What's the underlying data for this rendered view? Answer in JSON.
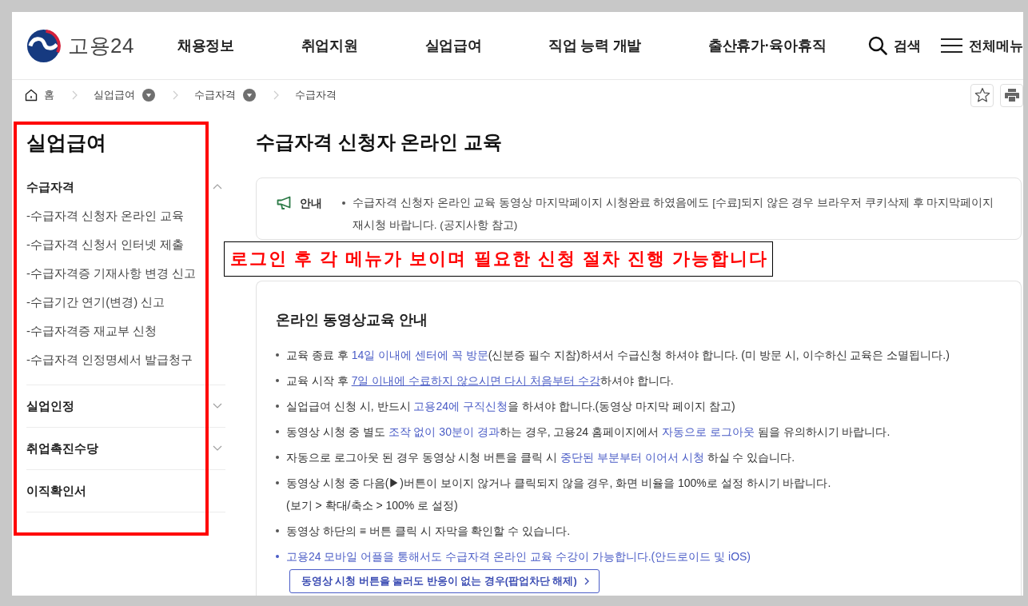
{
  "header": {
    "logo_text": "고용24",
    "nav": [
      "채용정보",
      "취업지원",
      "실업급여",
      "직업 능력 개발",
      "출산휴가·육아휴직"
    ],
    "search_label": "검색",
    "menu_label": "전체메뉴"
  },
  "breadcrumb": [
    {
      "label": "홈",
      "kind": "home"
    },
    {
      "label": "실업급여",
      "kind": "dropdown"
    },
    {
      "label": "수급자격",
      "kind": "dropdown"
    },
    {
      "label": "수급자격",
      "kind": "current"
    }
  ],
  "sidebar": {
    "title": "실업급여",
    "sections": [
      {
        "label": "수급자격",
        "kind": "group",
        "expanded": true,
        "children": [
          {
            "label": "-수급자격 신청자 온라인 교육"
          },
          {
            "label": "-수급자격 신청서 인터넷 제출"
          },
          {
            "label": "-수급자격증 기재사항 변경 신고"
          },
          {
            "label": "-수급기간 연기(변경) 신고"
          },
          {
            "label": "-수급자격증 재교부 신청"
          },
          {
            "label": "-수급자격 인정명세서 발급청구"
          }
        ]
      },
      {
        "label": "실업인정",
        "kind": "group",
        "expanded": false
      },
      {
        "label": "취업촉진수당",
        "kind": "group",
        "expanded": false
      },
      {
        "label": "이직확인서",
        "kind": "link"
      }
    ]
  },
  "page_title": "수급자격 신청자 온라인 교육",
  "notice": {
    "label": "안내",
    "text": "수급자격 신청자 온라인 교육 동영상 마지막페이지 시청완료 하였음에도 [수료]되지 않은 경우 브라우저 쿠키삭제 후 마지막페이지 재시청 바랍니다. (공지사항 참고)"
  },
  "guide": {
    "title": "온라인 동영상교육 안내",
    "items": [
      {
        "segments": [
          {
            "text": "교육 종료 후 ",
            "kind": "plain"
          },
          {
            "text": "14일 이내에 센터에 꼭 방문",
            "kind": "highlight"
          },
          {
            "text": "(신분증 필수 지참)하셔서 수급신청 하셔야 합니다. (미 방문 시, 이수하신 교육은 소멸됩니다.)",
            "kind": "plain"
          }
        ]
      },
      {
        "segments": [
          {
            "text": "교육 시작 후 ",
            "kind": "plain"
          },
          {
            "text": "7일 이내에 수료하지 않으시면 다시 처음부터 수강",
            "kind": "link"
          },
          {
            "text": "하셔야 합니다.",
            "kind": "plain"
          }
        ]
      },
      {
        "segments": [
          {
            "text": "실업급여 신청 시, 반드시 ",
            "kind": "plain"
          },
          {
            "text": "고용24에 구직신청",
            "kind": "highlight"
          },
          {
            "text": "을 하셔야 합니다.(동영상 마지막 페이지 참고)",
            "kind": "plain"
          }
        ]
      },
      {
        "segments": [
          {
            "text": "동영상 시청 중 별도 ",
            "kind": "plain"
          },
          {
            "text": "조작 없이 30분이 경과",
            "kind": "highlight"
          },
          {
            "text": "하는 경우, 고용24 홈페이지에서 ",
            "kind": "plain"
          },
          {
            "text": "자동으로 로그아웃",
            "kind": "highlight"
          },
          {
            "text": " 됨을 유의하시기 바랍니다.",
            "kind": "plain"
          }
        ]
      },
      {
        "segments": [
          {
            "text": "자동으로 로그아웃 된 경우 동영상 시청 버튼을 클릭 시 ",
            "kind": "plain"
          },
          {
            "text": "중단된 부분부터 이어서 시청",
            "kind": "highlight"
          },
          {
            "text": " 하실 수 있습니다.",
            "kind": "plain"
          }
        ]
      },
      {
        "segments": [
          {
            "text": "동영상 시청 중 다음(▶)버튼이 보이지 않거나 클릭되지 않을 경우, 화면 비율을 100%로 설정 하시기 바랍니다.",
            "kind": "plain"
          }
        ],
        "note": "(보기 > 확대/축소 > 100% 로 설정)"
      },
      {
        "segments": [
          {
            "text": "동영상 하단의 ≡ 버튼 클릭 시 자막을 확인할 수 있습니다.",
            "kind": "plain"
          }
        ]
      },
      {
        "segments": [
          {
            "text": "고용24 모바일 어플을 통해서도 수급자격 온라인 교육 수강이 가능합니다.(안드로이드 및 iOS)",
            "kind": "highlight"
          }
        ]
      }
    ],
    "button_label": "동영상 시청 버튼을 눌러도 반응이 없는 경우(팝업차단 해제)"
  },
  "annotation": {
    "text": "로그인 후 각 메뉴가 보이며 필요한 신청 절차 진행 가능합니다"
  }
}
